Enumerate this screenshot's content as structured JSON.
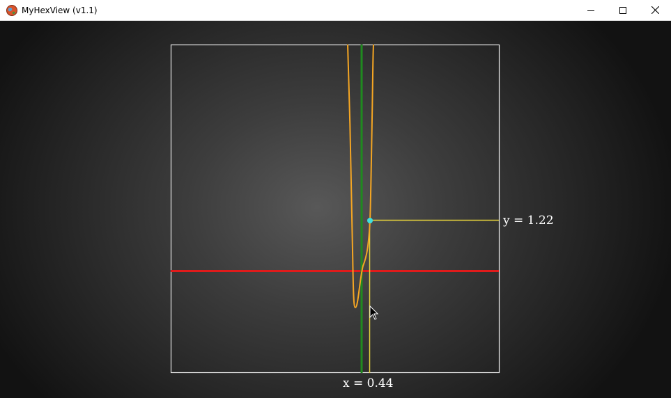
{
  "window": {
    "title": "MyHexView (v1.1)",
    "icon": "app-globe-icon",
    "controls": [
      "minimize-icon",
      "maximize-icon",
      "close-icon"
    ]
  },
  "plot": {
    "x_label": "x = 0.44",
    "y_label": "y = 1.22",
    "x_value": 0.44,
    "y_value": 1.22,
    "colors": {
      "curve": "#f5a623",
      "x_axis": "#e01b1b",
      "y_axis": "#1f8a1f",
      "crosshair": "#e6d23c",
      "point": "#3ee0e0",
      "frame": "#e8e8e8"
    }
  }
}
